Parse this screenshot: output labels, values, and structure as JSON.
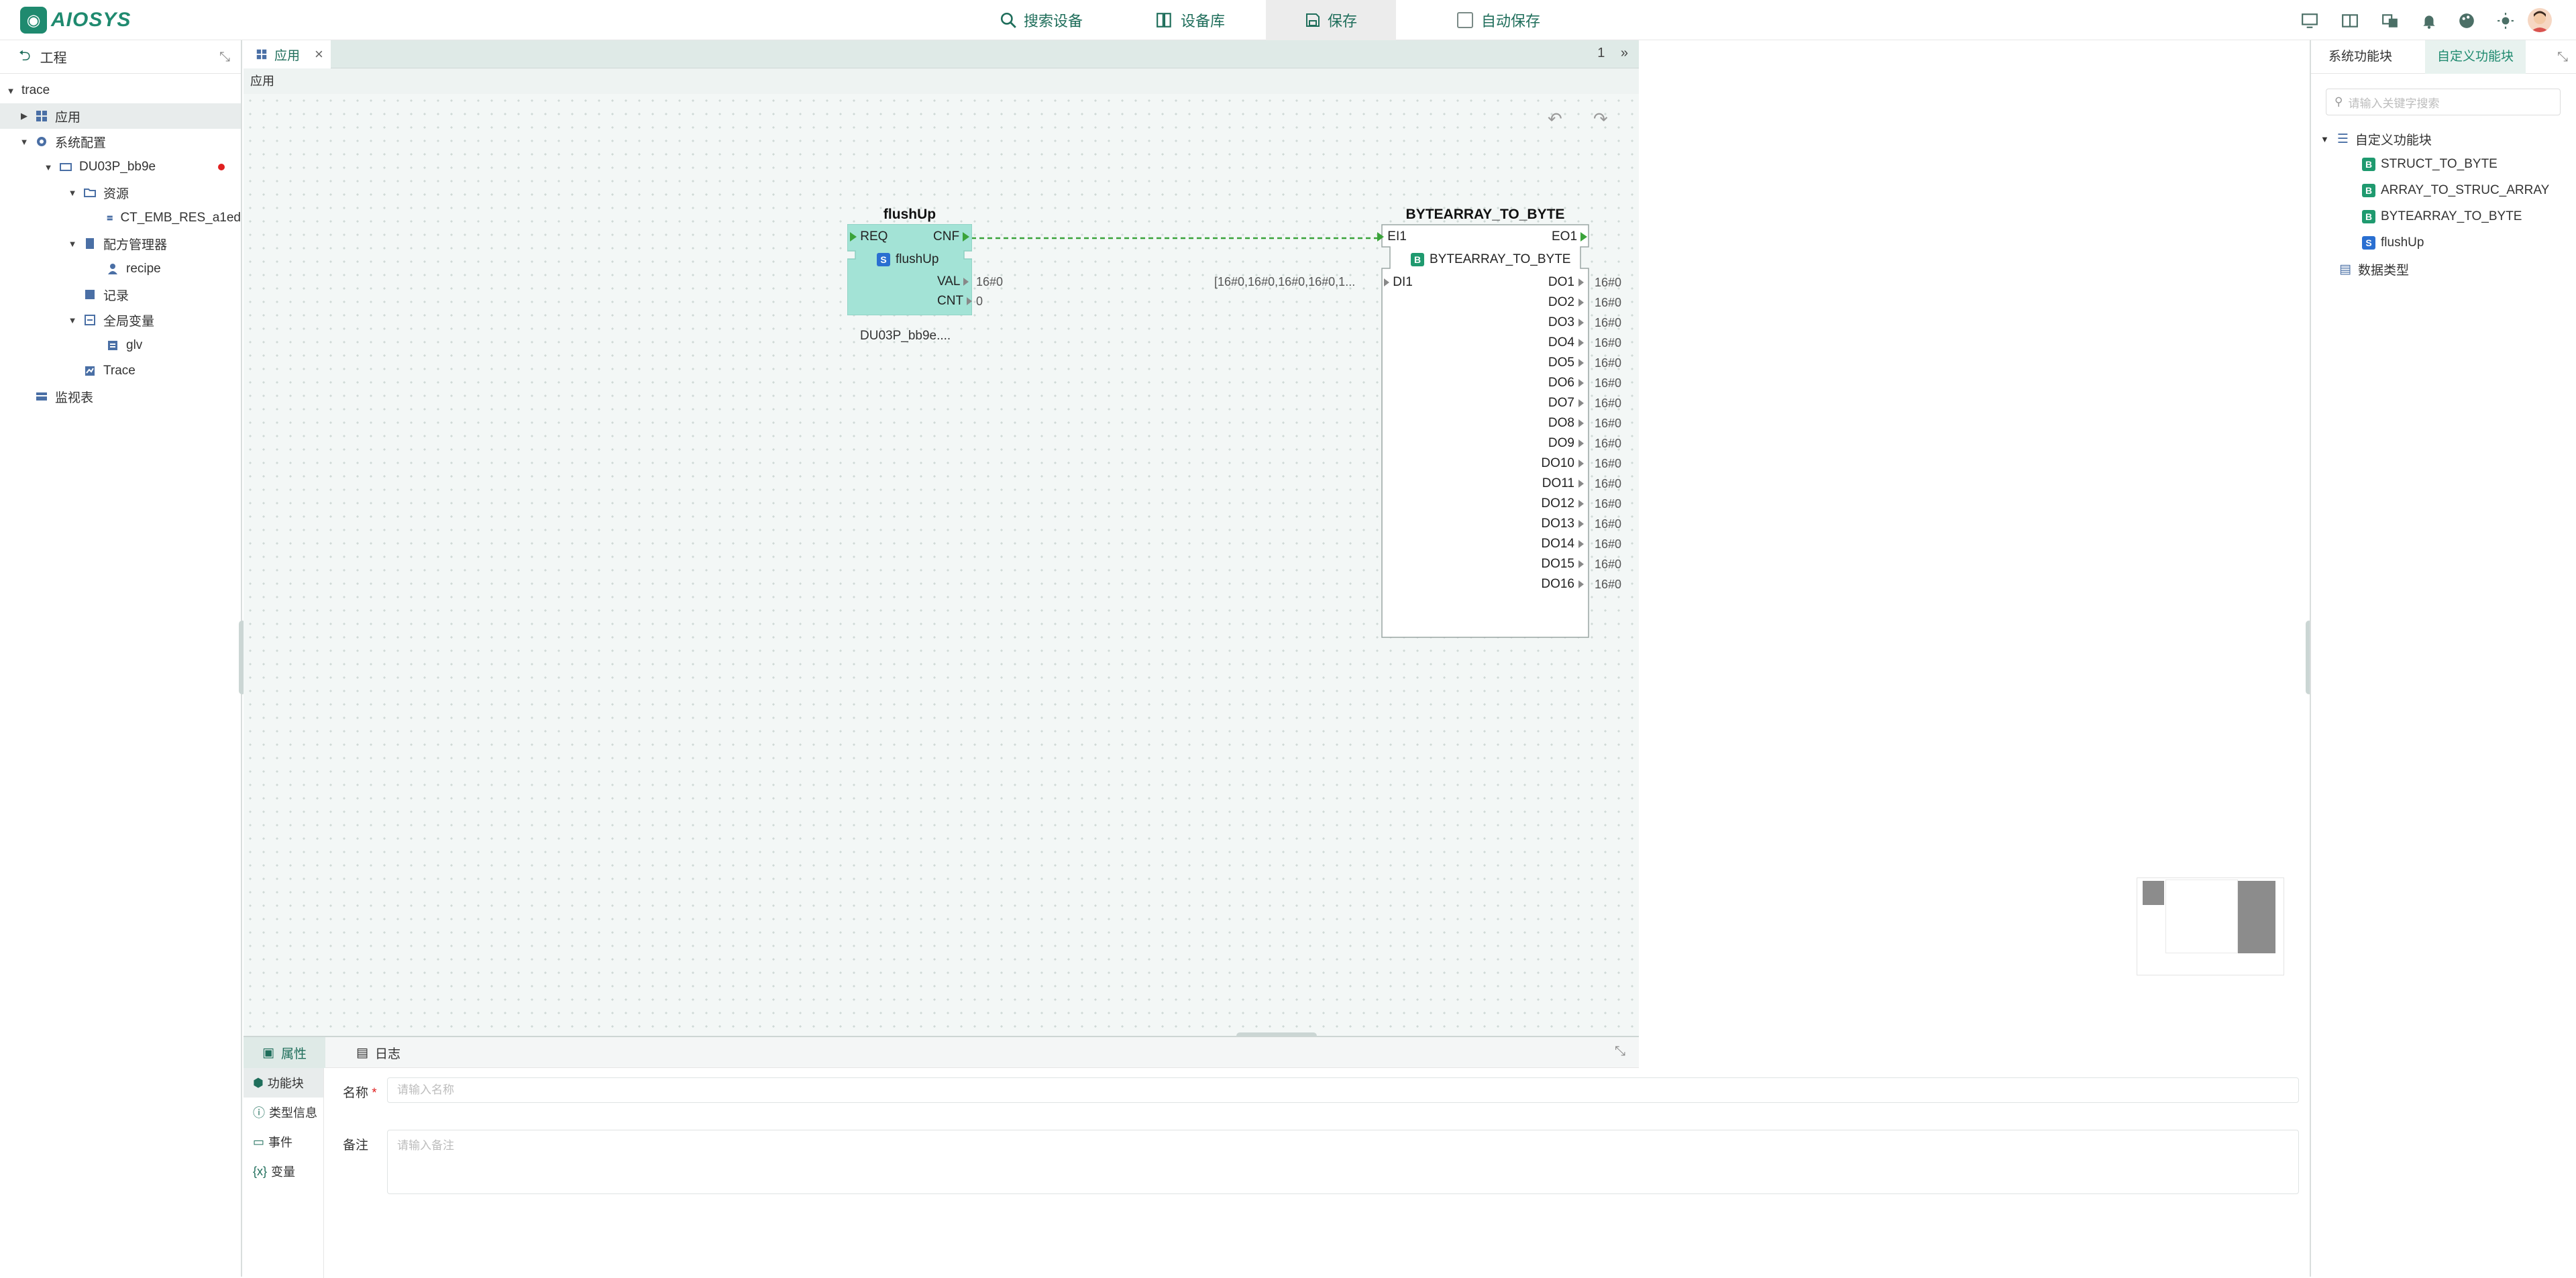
{
  "app": {
    "logo_text": "AIOSYS"
  },
  "toolbar": {
    "search_device": "搜索设备",
    "device_library": "设备库",
    "save": "保存",
    "auto_save": "自动保存"
  },
  "project": {
    "title": "工程",
    "tree": [
      {
        "label": "trace"
      },
      {
        "label": "应用"
      },
      {
        "label": "系统配置"
      },
      {
        "label": "DU03P_bb9e"
      },
      {
        "label": "资源"
      },
      {
        "label": "CT_EMB_RES_a1ed"
      },
      {
        "label": "配方管理器"
      },
      {
        "label": "recipe"
      },
      {
        "label": "记录"
      },
      {
        "label": "全局变量"
      },
      {
        "label": "glv"
      },
      {
        "label": "Trace"
      },
      {
        "label": "监视表"
      }
    ]
  },
  "editor": {
    "tab_label": "应用",
    "tab_page": "1",
    "breadcrumb": "应用"
  },
  "flushup_block": {
    "title": "flushUp",
    "event_in": "REQ",
    "event_out": "CNF",
    "type_name": "flushUp",
    "outputs": [
      {
        "name": "VAL",
        "value": "16#0"
      },
      {
        "name": "CNT",
        "value": "0"
      }
    ],
    "instance_label": "DU03P_bb9e...."
  },
  "bytearray_block": {
    "title": "BYTEARRAY_TO_BYTE",
    "event_in": "EI1",
    "event_out": "EO1",
    "type_name": "BYTEARRAY_TO_BYTE",
    "input_name": "DI1",
    "input_value": "[16#0,16#0,16#0,16#0,1...",
    "outputs": [
      {
        "name": "DO1",
        "value": "16#0"
      },
      {
        "name": "DO2",
        "value": "16#0"
      },
      {
        "name": "DO3",
        "value": "16#0"
      },
      {
        "name": "DO4",
        "value": "16#0"
      },
      {
        "name": "DO5",
        "value": "16#0"
      },
      {
        "name": "DO6",
        "value": "16#0"
      },
      {
        "name": "DO7",
        "value": "16#0"
      },
      {
        "name": "DO8",
        "value": "16#0"
      },
      {
        "name": "DO9",
        "value": "16#0"
      },
      {
        "name": "DO10",
        "value": "16#0"
      },
      {
        "name": "DO11",
        "value": "16#0"
      },
      {
        "name": "DO12",
        "value": "16#0"
      },
      {
        "name": "DO13",
        "value": "16#0"
      },
      {
        "name": "DO14",
        "value": "16#0"
      },
      {
        "name": "DO15",
        "value": "16#0"
      },
      {
        "name": "DO16",
        "value": "16#0"
      }
    ]
  },
  "bottom": {
    "tab_properties": "属性",
    "tab_log": "日志",
    "menu": [
      "功能块",
      "类型信息",
      "事件",
      "变量"
    ],
    "name_label": "名称",
    "required_mark": "*",
    "name_placeholder": "请输入名称",
    "remark_label": "备注",
    "remark_placeholder": "请输入备注"
  },
  "library": {
    "tab_system": "系统功能块",
    "tab_custom": "自定义功能块",
    "search_placeholder": "请输入关键字搜索",
    "folder_custom": "自定义功能块",
    "items": [
      {
        "badge": "B",
        "label": "STRUCT_TO_BYTE"
      },
      {
        "badge": "B",
        "label": "ARRAY_TO_STRUC_ARRAY"
      },
      {
        "badge": "B",
        "label": "BYTEARRAY_TO_BYTE"
      },
      {
        "badge": "S",
        "label": "flushUp"
      }
    ],
    "folder_types": "数据类型"
  }
}
